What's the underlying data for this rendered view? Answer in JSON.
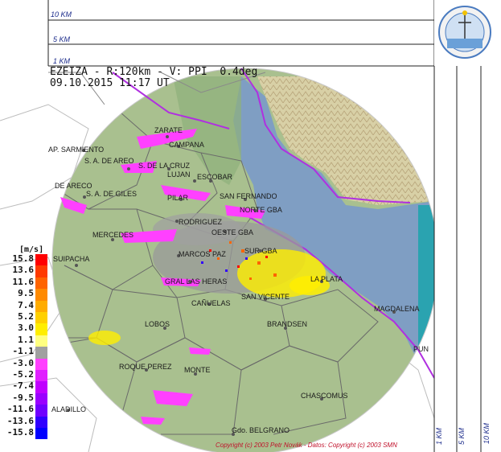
{
  "header": {
    "line1": "EZEIZA - R:120km - V: PPI  0.4deg",
    "line2": "09.10.2015 11:17 UT"
  },
  "top_scale": {
    "labels": [
      "10 KM",
      "5 KM",
      "1 KM"
    ]
  },
  "side_scale": {
    "labels": [
      "1 KM",
      "5 KM",
      "10 KM"
    ]
  },
  "legend": {
    "title": "[m/s]",
    "labels": [
      "15.8",
      "13.6",
      "11.6",
      "9.5",
      "7.4",
      "5.2",
      "3.0",
      "1.1",
      "-1.1",
      "-3.0",
      "-5.2",
      "-7.4",
      "-9.5",
      "-11.6",
      "-13.6",
      "-15.8"
    ],
    "colors": [
      "#ff0000",
      "#ff3a00",
      "#ff6400",
      "#ff8a00",
      "#ffac00",
      "#ffd000",
      "#ffee00",
      "#ffff80",
      "#a0a0a0",
      "#ff40ff",
      "#e020ff",
      "#c000ff",
      "#9a00ff",
      "#7000ff",
      "#3000ff",
      "#0000ff"
    ]
  },
  "places": [
    {
      "name": "ZARATE",
      "id": "zarate"
    },
    {
      "name": "CAMPANA",
      "id": "campana"
    },
    {
      "name": "AP. SARMIENTO",
      "id": "ap-sarmiento"
    },
    {
      "name": "S. A. DE AREO",
      "id": "sa-de-areco-1"
    },
    {
      "name": "S. DE LA CRUZ",
      "id": "s-de-la-cruz"
    },
    {
      "name": "LUJAN",
      "id": "lujan"
    },
    {
      "name": "ESCOBAR",
      "id": "escobar"
    },
    {
      "name": "DE ARECO",
      "id": "de-areco"
    },
    {
      "name": "S. A. DE GILES",
      "id": "sa-de-giles"
    },
    {
      "name": "PILAR",
      "id": "pilar"
    },
    {
      "name": "SAN FERNANDO",
      "id": "san-fernando"
    },
    {
      "name": "NORTE GBA",
      "id": "norte-gba"
    },
    {
      "name": "RODRIGUEZ",
      "id": "rodriguez"
    },
    {
      "name": "OESTE GBA",
      "id": "oeste-gba"
    },
    {
      "name": "MERCEDES",
      "id": "mercedes"
    },
    {
      "name": "MARCOS PAZ",
      "id": "marcos-paz"
    },
    {
      "name": "SUR GBA",
      "id": "sur-gba"
    },
    {
      "name": "SUIPACHA",
      "id": "suipacha"
    },
    {
      "name": "GRAL LAS HERAS",
      "id": "gral-las-heras"
    },
    {
      "name": "LA PLATA",
      "id": "la-plata"
    },
    {
      "name": "SAN VICENTE",
      "id": "san-vicente"
    },
    {
      "name": "CAÑUELAS",
      "id": "canuelas"
    },
    {
      "name": "MAGDALENA",
      "id": "magdalena"
    },
    {
      "name": "LOBOS",
      "id": "lobos"
    },
    {
      "name": "BRANDSEN",
      "id": "brandsen"
    },
    {
      "name": "PUN",
      "id": "punta-indio"
    },
    {
      "name": "ROQUE PEREZ",
      "id": "roque-perez"
    },
    {
      "name": "MONTE",
      "id": "monte"
    },
    {
      "name": "CHASCOMUS",
      "id": "chascomus"
    },
    {
      "name": "ALADILLO",
      "id": "saladillo"
    },
    {
      "name": "Gdo. BELGRANO",
      "id": "gdo-belgrano"
    }
  ],
  "copyright": "Copyright (c) 2003 Petr Novák - Datos: Copyright (c) 2003 SMN",
  "colors": {
    "land": "#a9c08f",
    "water": "#7f9ec3",
    "hills": "#d9cfa8",
    "outside": "#ffffff",
    "coast_purple": "#b030e0"
  }
}
